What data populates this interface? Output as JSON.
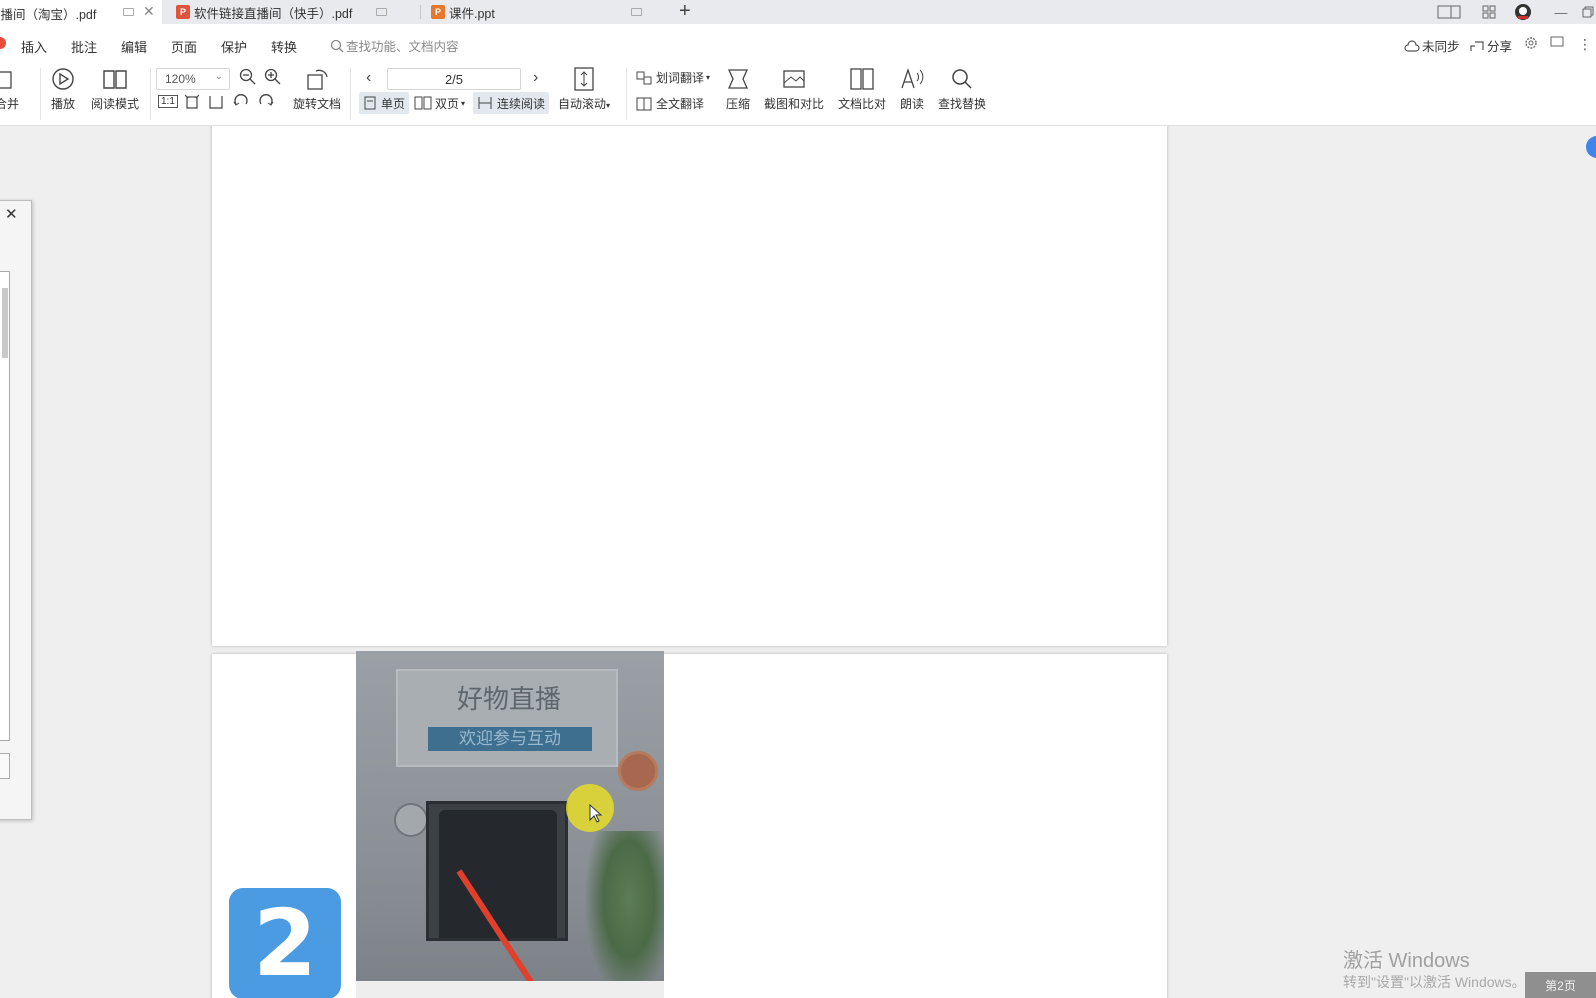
{
  "tabs": [
    {
      "label": "直播间（淘宝）.pdf",
      "type": "pdf",
      "active": true
    },
    {
      "label": "软件链接直播间（快手）.pdf",
      "type": "pdf",
      "active": false
    },
    {
      "label": "课件.ppt",
      "type": "ppt",
      "active": false
    }
  ],
  "newtab": "+",
  "menu": {
    "items": [
      "插入",
      "批注",
      "编辑",
      "页面",
      "保护",
      "转换"
    ],
    "search_placeholder": "查找功能、文档内容",
    "sync": "未同步",
    "share": "分享"
  },
  "toolbar": {
    "merge": "合并",
    "play": "播放",
    "read_mode": "阅读模式",
    "zoom": "120%",
    "rotate": "旋转文档",
    "page_indicator": "2/5",
    "single_page": "单页",
    "double_page": "双页",
    "continuous": "连续阅读",
    "auto_scroll": "自动滚动",
    "word_translate": "划词翻译",
    "full_translate": "全文翻译",
    "compress": "压缩",
    "screenshot_compare": "截图和对比",
    "doc_compare": "文档比对",
    "read_aloud": "朗读",
    "find_replace": "查找替换",
    "fit_label": "1:1"
  },
  "document": {
    "sign_title": "好物直播",
    "sign_subtitle": "欢迎参与互动",
    "badge_number": "2"
  },
  "watermark": {
    "line1": "激活 Windows",
    "line2": "转到\"设置\"以激活 Windows。"
  },
  "page_badge": "第2页"
}
